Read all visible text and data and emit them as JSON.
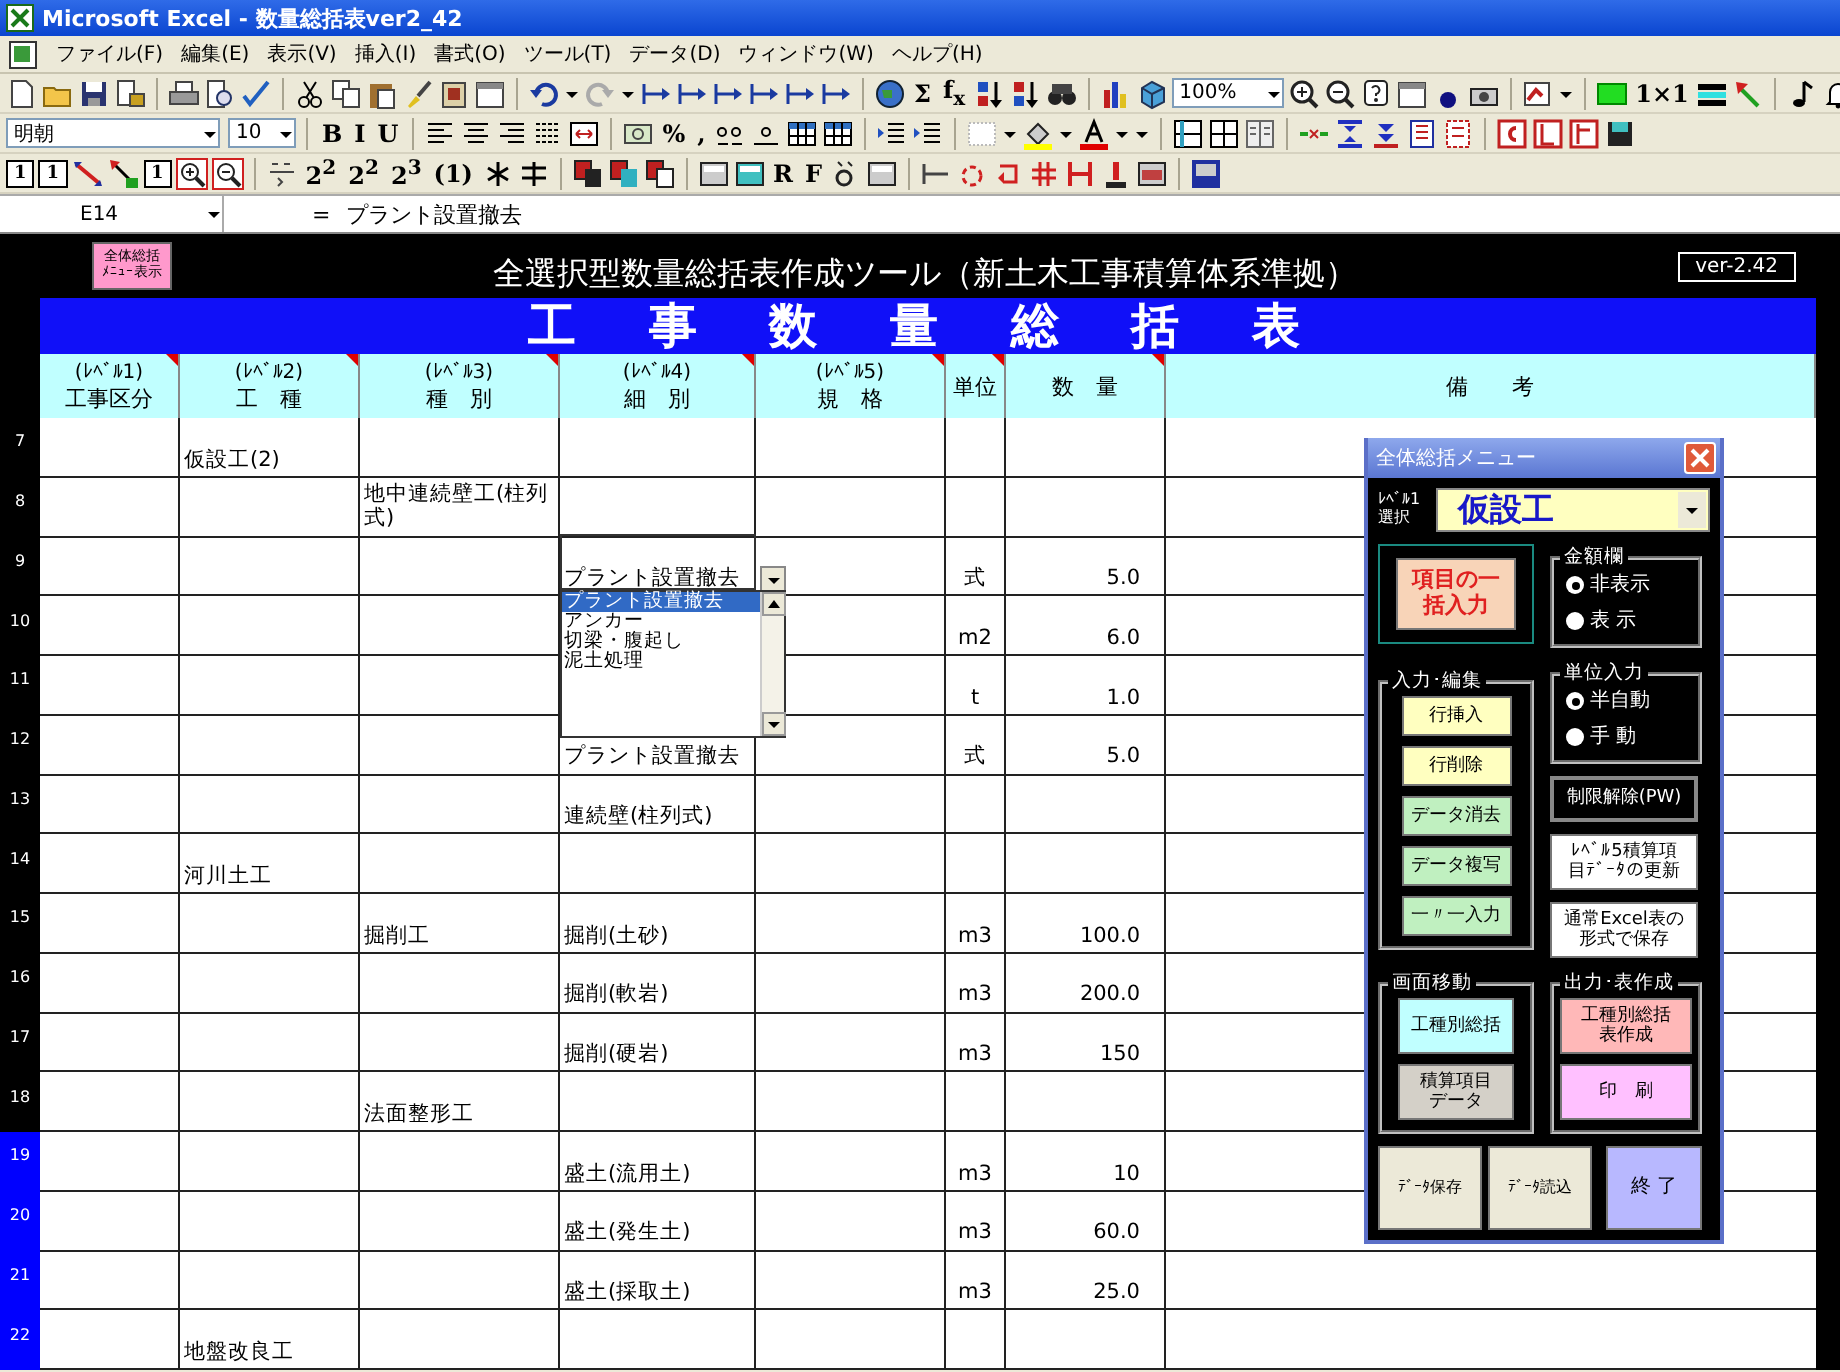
{
  "window": {
    "title": "Microsoft Excel - 数量総括表ver2_42"
  },
  "menu": [
    "ファイル(F)",
    "編集(E)",
    "表示(V)",
    "挿入(I)",
    "書式(O)",
    "ツール(T)",
    "データ(D)",
    "ウィンドウ(W)",
    "ヘルプ(H)"
  ],
  "standard_toolbar": {
    "labels": [
      "Σ",
      "f$_{x}$",
      "1×1"
    ],
    "zoom": "100%"
  },
  "formatting_toolbar": {
    "font": "明朝",
    "size": "10",
    "labels": [
      "B",
      "I",
      "U",
      "%",
      ","
    ]
  },
  "extra_toolbar": {
    "labels": [
      "1",
      "1",
      "1",
      "2$^{2}$",
      "2$^{2}$",
      "2$^{3}$",
      "(1)",
      "R",
      "F"
    ]
  },
  "formula_bar": {
    "cell": "E14",
    "equals": "=",
    "value": "プラント設置撤去"
  },
  "sheet": {
    "menu_button": "全体総括ﾒﾆｭｰ表示",
    "heading": "全選択型数量総括表作成ツール（新土木工事積算体系準拠）",
    "version": "ver-2.42",
    "banner": "工 事 数 量 総 括 表",
    "columns": [
      {
        "level": "(ﾚﾍﾞﾙ1)",
        "label": "工事区分",
        "comment": true
      },
      {
        "level": "(ﾚﾍﾞﾙ2)",
        "label": "工　種",
        "comment": true
      },
      {
        "level": "(ﾚﾍﾞﾙ3)",
        "label": "種　別",
        "comment": true
      },
      {
        "level": "(ﾚﾍﾞﾙ4)",
        "label": "細　別",
        "comment": true
      },
      {
        "level": "(ﾚﾍﾞﾙ5)",
        "label": "規　格",
        "comment": true
      },
      {
        "label": "単位",
        "comment": true
      },
      {
        "label": "数　量",
        "comment": true
      },
      {
        "label": "備　　考",
        "comment": false
      }
    ],
    "rows": [
      {
        "number": "7",
        "selected": false,
        "level_2": "仮設工(2)"
      },
      {
        "number": "8",
        "selected": false,
        "level_3": "地中連続壁工(柱列式)"
      },
      {
        "number": "9",
        "selected": false,
        "level_4": "プラント設置撤去",
        "unit": "式",
        "quantity": "5.0"
      },
      {
        "number": "10",
        "selected": false,
        "unit": "m2",
        "quantity": "6.0"
      },
      {
        "number": "11",
        "selected": false,
        "unit": "t",
        "quantity": "1.0"
      },
      {
        "number": "12",
        "selected": false,
        "level_4": "プラント設置撤去",
        "unit": "式",
        "quantity": "5.0"
      },
      {
        "number": "13",
        "selected": false,
        "level_4": "連続壁(柱列式)"
      },
      {
        "number": "14",
        "selected": false,
        "level_2": "河川土工"
      },
      {
        "number": "15",
        "selected": false,
        "level_3": "掘削工",
        "level_4": "掘削(土砂)",
        "unit": "m3",
        "quantity": "100.0"
      },
      {
        "number": "16",
        "selected": false,
        "level_4": "掘削(軟岩)",
        "unit": "m3",
        "quantity": "200.0"
      },
      {
        "number": "17",
        "selected": false,
        "level_4": "掘削(硬岩)",
        "unit": "m3",
        "quantity": "150"
      },
      {
        "number": "18",
        "selected": false,
        "level_3": "法面整形工"
      },
      {
        "number": "19",
        "selected": true,
        "level_4": "盛土(流用土)",
        "unit": "m3",
        "quantity": "10"
      },
      {
        "number": "20",
        "selected": true,
        "level_4": "盛土(発生土)",
        "unit": "m3",
        "quantity": "60.0"
      },
      {
        "number": "21",
        "selected": true,
        "level_4": "盛土(採取土)",
        "unit": "m3",
        "quantity": "25.0"
      },
      {
        "number": "22",
        "selected": true,
        "level_2": "地盤改良工"
      }
    ]
  },
  "cell_dropdown": {
    "items": [
      {
        "label": "プラント設置撤去",
        "selected": true
      },
      {
        "label": "アンカー",
        "selected": false
      },
      {
        "label": "切梁・腹起し",
        "selected": false
      },
      {
        "label": "泥土処理",
        "selected": false
      }
    ]
  },
  "menu_panel": {
    "title": "全体総括メニュー",
    "level_label": "ﾚﾍﾞﾙ1選択",
    "level_value": "仮設工",
    "bulk_button": "項目の一括入力",
    "amount_column": {
      "title": "金額欄",
      "options": [
        {
          "label": "非表示",
          "selected": true
        },
        {
          "label": "表 示",
          "selected": false
        }
      ]
    },
    "edit_group": {
      "title": "入力･編集",
      "buttons": [
        {
          "label": "行挿入",
          "color": "#ffffc0"
        },
        {
          "label": "行削除",
          "color": "#ffffc0"
        },
        {
          "label": "データ消去",
          "color": "#c0f0c0"
        },
        {
          "label": "データ複写",
          "color": "#c0f0c0"
        },
        {
          "label": "一〃一入力",
          "color": "#c0f0c0"
        }
      ]
    },
    "unit_input": {
      "title": "単位入力",
      "options": [
        {
          "label": "半自動",
          "selected": true
        },
        {
          "label": "手 動",
          "selected": false
        }
      ]
    },
    "side_buttons": [
      {
        "label": "制限解除(PW)",
        "kind": "dark"
      },
      {
        "label": "ﾚﾍﾞﾙ5積算項目ﾃﾞｰﾀの更新",
        "kind": "light"
      },
      {
        "label": "通常Excel表の形式で保存",
        "kind": "light"
      }
    ],
    "navigate": {
      "title": "画面移動",
      "buttons": [
        {
          "label": "工種別総括",
          "color": "#c0ffff"
        },
        {
          "label": "積算項目データ",
          "color": "#d4d0c8"
        }
      ]
    },
    "output": {
      "title": "出力･表作成",
      "buttons": [
        {
          "label": "工種別総括表作成",
          "color": "#ffb8b8"
        },
        {
          "label": "印　刷",
          "color": "#ffc0ff"
        }
      ]
    },
    "bottom_buttons": [
      {
        "label": "ﾃﾞｰﾀ保存",
        "color": "#ece9d8"
      },
      {
        "label": "ﾃﾞｰﾀ読込",
        "color": "#ece9d8"
      },
      {
        "label": "終 了",
        "color": "#b8b8ff"
      }
    ]
  }
}
